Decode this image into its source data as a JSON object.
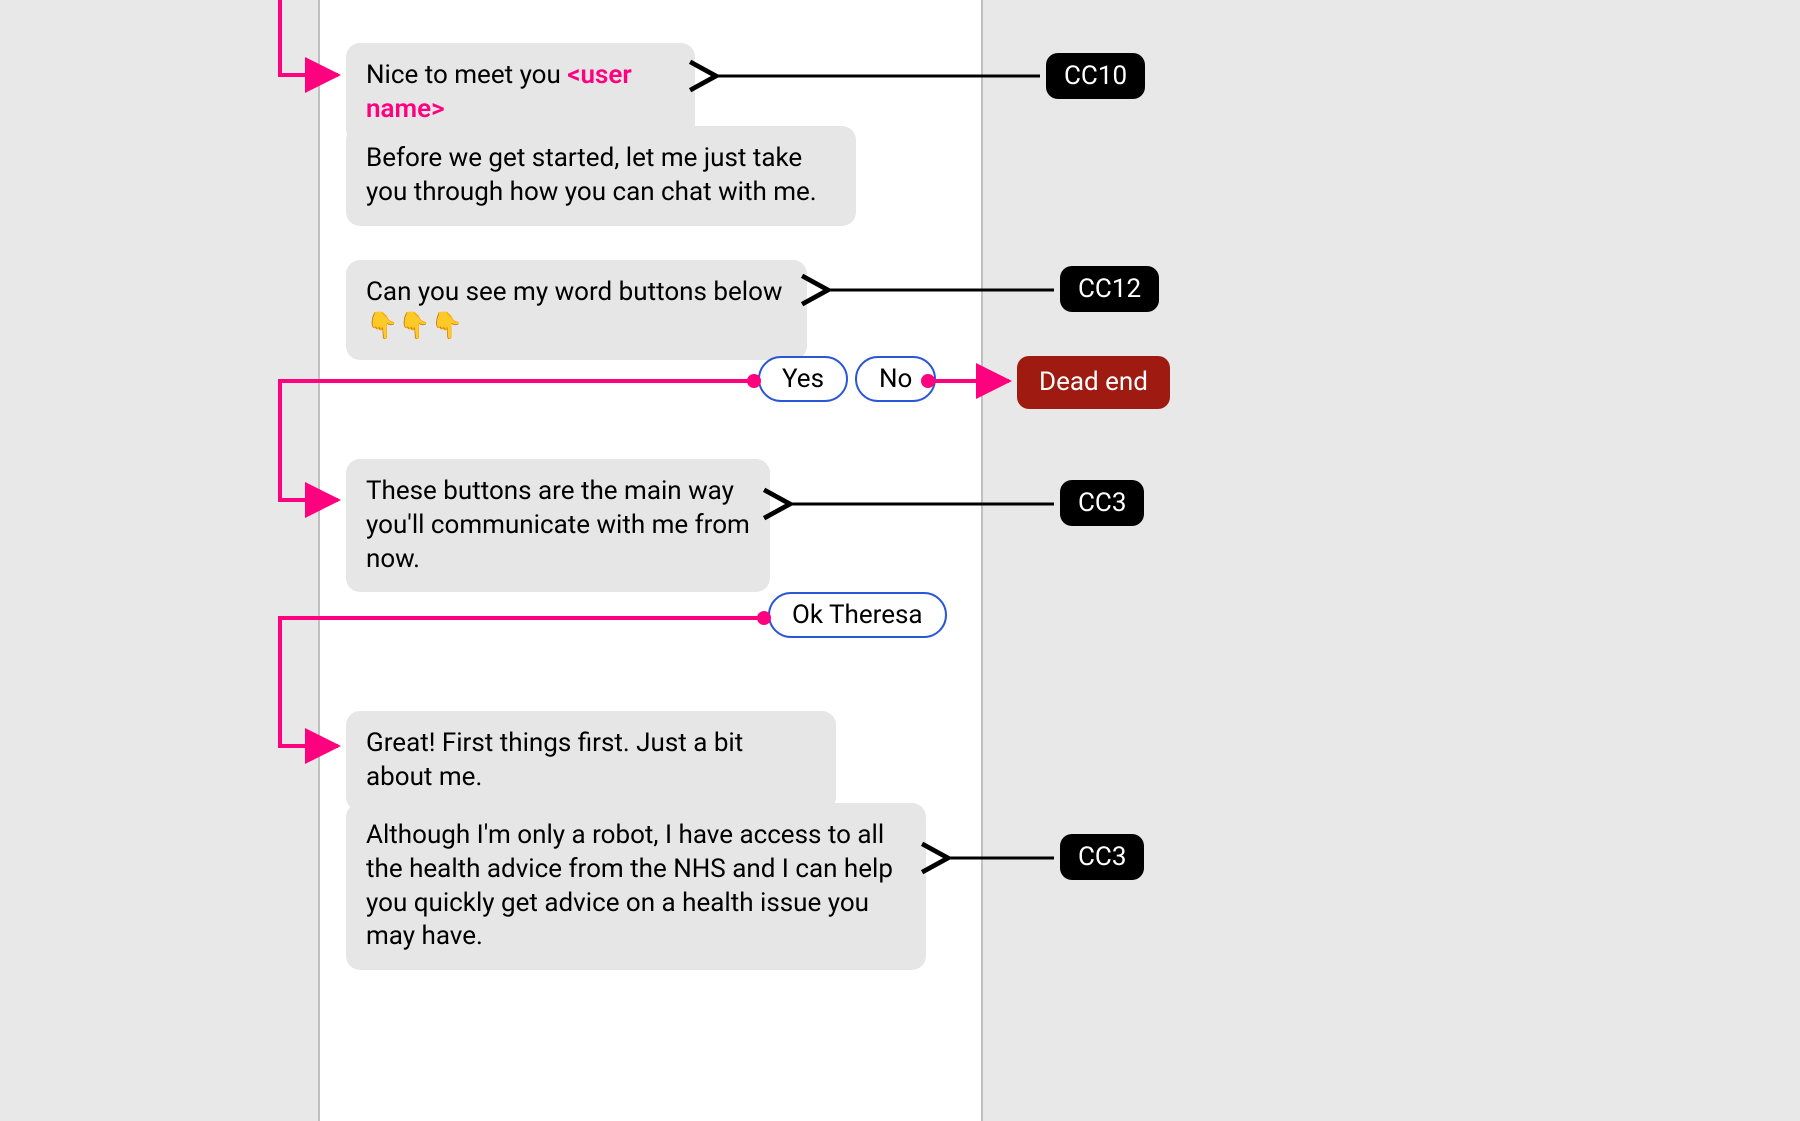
{
  "chat": {
    "bubble1_prefix": "Nice to meet you ",
    "bubble1_accent": "<user name>",
    "bubble2": "Before we get started, let me just take you through how you can chat with me.",
    "bubble3": "Can you see my word buttons below 👇👇👇",
    "bubble4": "These buttons are the main way you'll communicate with me from now.",
    "bubble5": "Great! First things first. Just a bit about me.",
    "bubble6": "Although I'm only a robot, I have access to all the health advice from the NHS and I can help you quickly get advice on a health issue you may have."
  },
  "options": {
    "yes": "Yes",
    "no": "No",
    "ok": "Ok Theresa"
  },
  "annotations": {
    "a1": "CC10",
    "a2": "CC12",
    "a3": "CC3",
    "a4": "CC3",
    "dead_end": "Dead end"
  }
}
